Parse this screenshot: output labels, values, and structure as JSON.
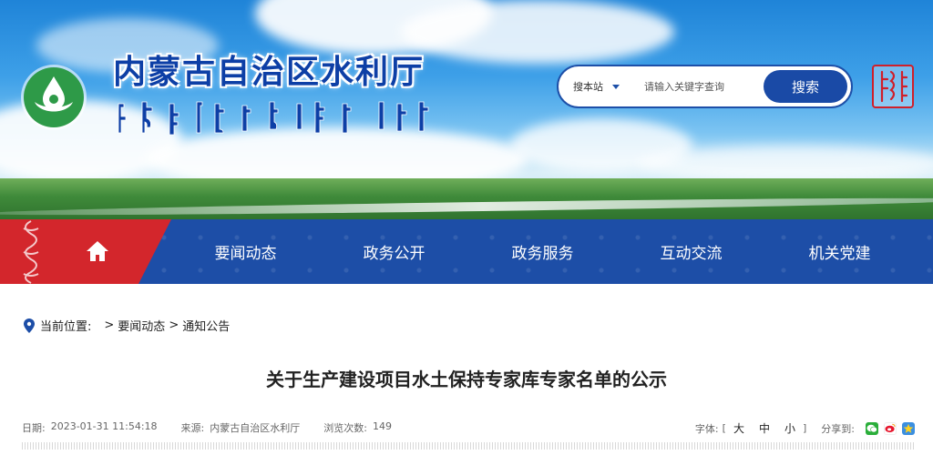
{
  "header": {
    "site_title": "内蒙古自治区水利厅",
    "logo": "water-drop-logo",
    "seal": "mongolian-seal"
  },
  "search": {
    "scope": "搜本站",
    "placeholder": "请输入关键字查询",
    "button_label": "搜索"
  },
  "nav": {
    "home_icon": "home-icon",
    "items": [
      {
        "label": "要闻动态"
      },
      {
        "label": "政务公开"
      },
      {
        "label": "政务服务"
      },
      {
        "label": "互动交流"
      },
      {
        "label": "机关党建"
      }
    ]
  },
  "breadcrumb": {
    "prefix": "当前位置:",
    "sep1": ">",
    "item1": "要闻动态",
    "sep2": ">",
    "item2": "通知公告"
  },
  "article": {
    "title": "关于生产建设项目水土保持专家库专家名单的公示",
    "date_label": "日期:",
    "date": "2023-01-31 11:54:18",
    "source_label": "来源:",
    "source": "内蒙古自治区水利厅",
    "views_label": "浏览次数:",
    "views": "149",
    "font_label": "字体:",
    "bracket_open": "[",
    "font_large": "大",
    "font_medium": "中",
    "font_small": "小",
    "bracket_close": "]",
    "share_label": "分享到:"
  },
  "colors": {
    "primary_blue": "#1d4ea7",
    "home_red": "#d3262c",
    "title_blue": "#0d3fa6",
    "wechat_green": "#2aae3a",
    "weibo_red": "#e6162d",
    "qzone_blue": "#3b8fe0"
  }
}
